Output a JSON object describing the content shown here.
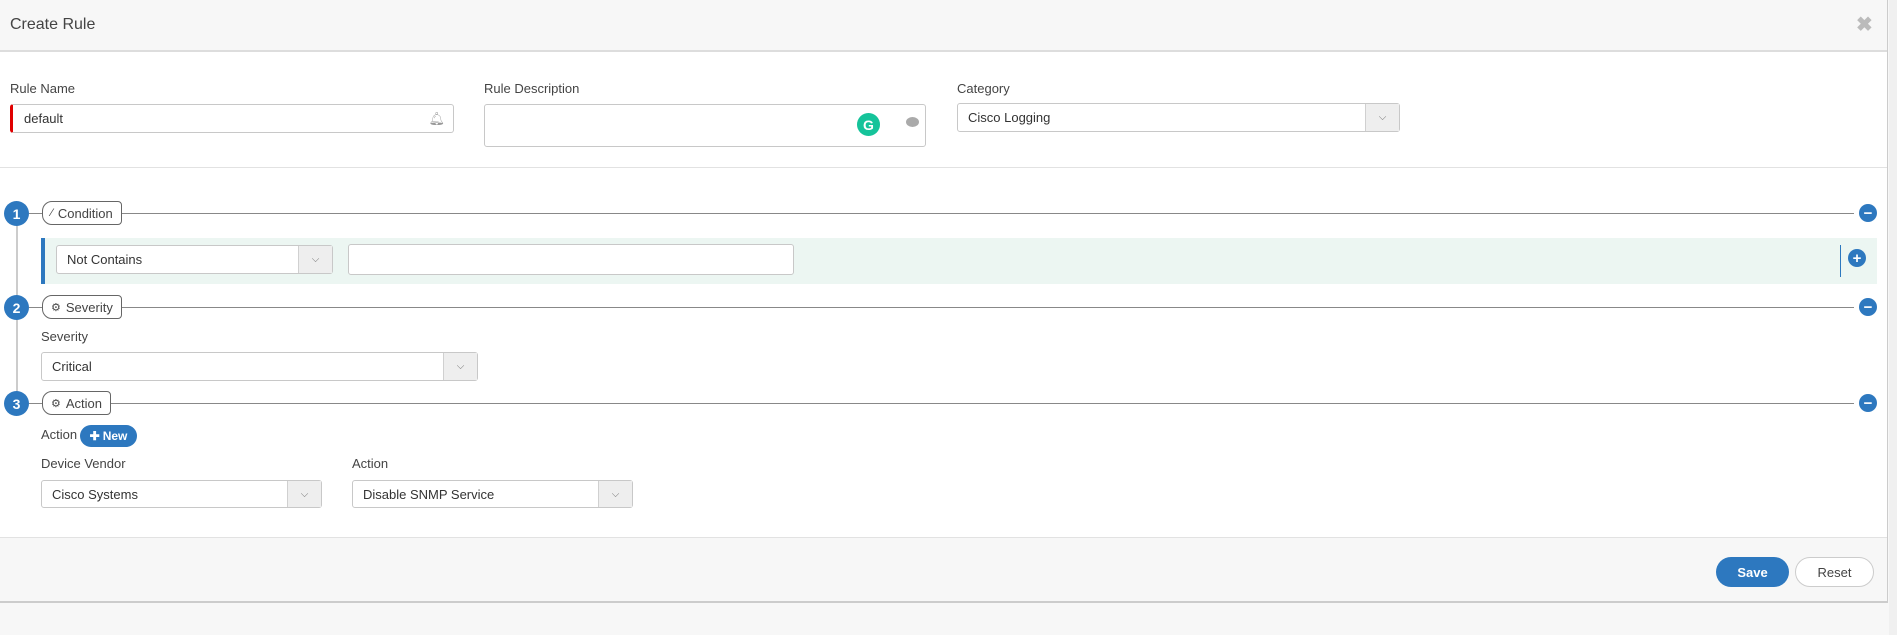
{
  "modal": {
    "title": "Create Rule",
    "close_icon": "close-icon"
  },
  "form": {
    "rule_name": {
      "label": "Rule Name",
      "value": "default",
      "icon": "bell-icon"
    },
    "rule_description": {
      "label": "Rule Description",
      "value": "",
      "icons": [
        "grammarly-icon",
        "comment-icon"
      ]
    },
    "category": {
      "label": "Category",
      "value": "Cisco Logging"
    }
  },
  "steps": [
    {
      "number": "1",
      "label": "Condition",
      "icon": "magic-wand-icon",
      "operator": "Not Contains",
      "value": ""
    },
    {
      "number": "2",
      "label": "Severity",
      "icon": "gears-icon",
      "field_label": "Severity",
      "value": "Critical"
    },
    {
      "number": "3",
      "label": "Action",
      "icon": "gears-icon",
      "field_label": "Action",
      "new_button": "New",
      "device_vendor_label": "Device Vendor",
      "device_vendor": "Cisco Systems",
      "action_label": "Action",
      "action": "Disable SNMP Service"
    }
  ],
  "footer": {
    "save": "Save",
    "reset": "Reset"
  },
  "colors": {
    "accent": "#2d78bf",
    "condition_bg": "#ecf6f2",
    "required": "#e00000"
  }
}
